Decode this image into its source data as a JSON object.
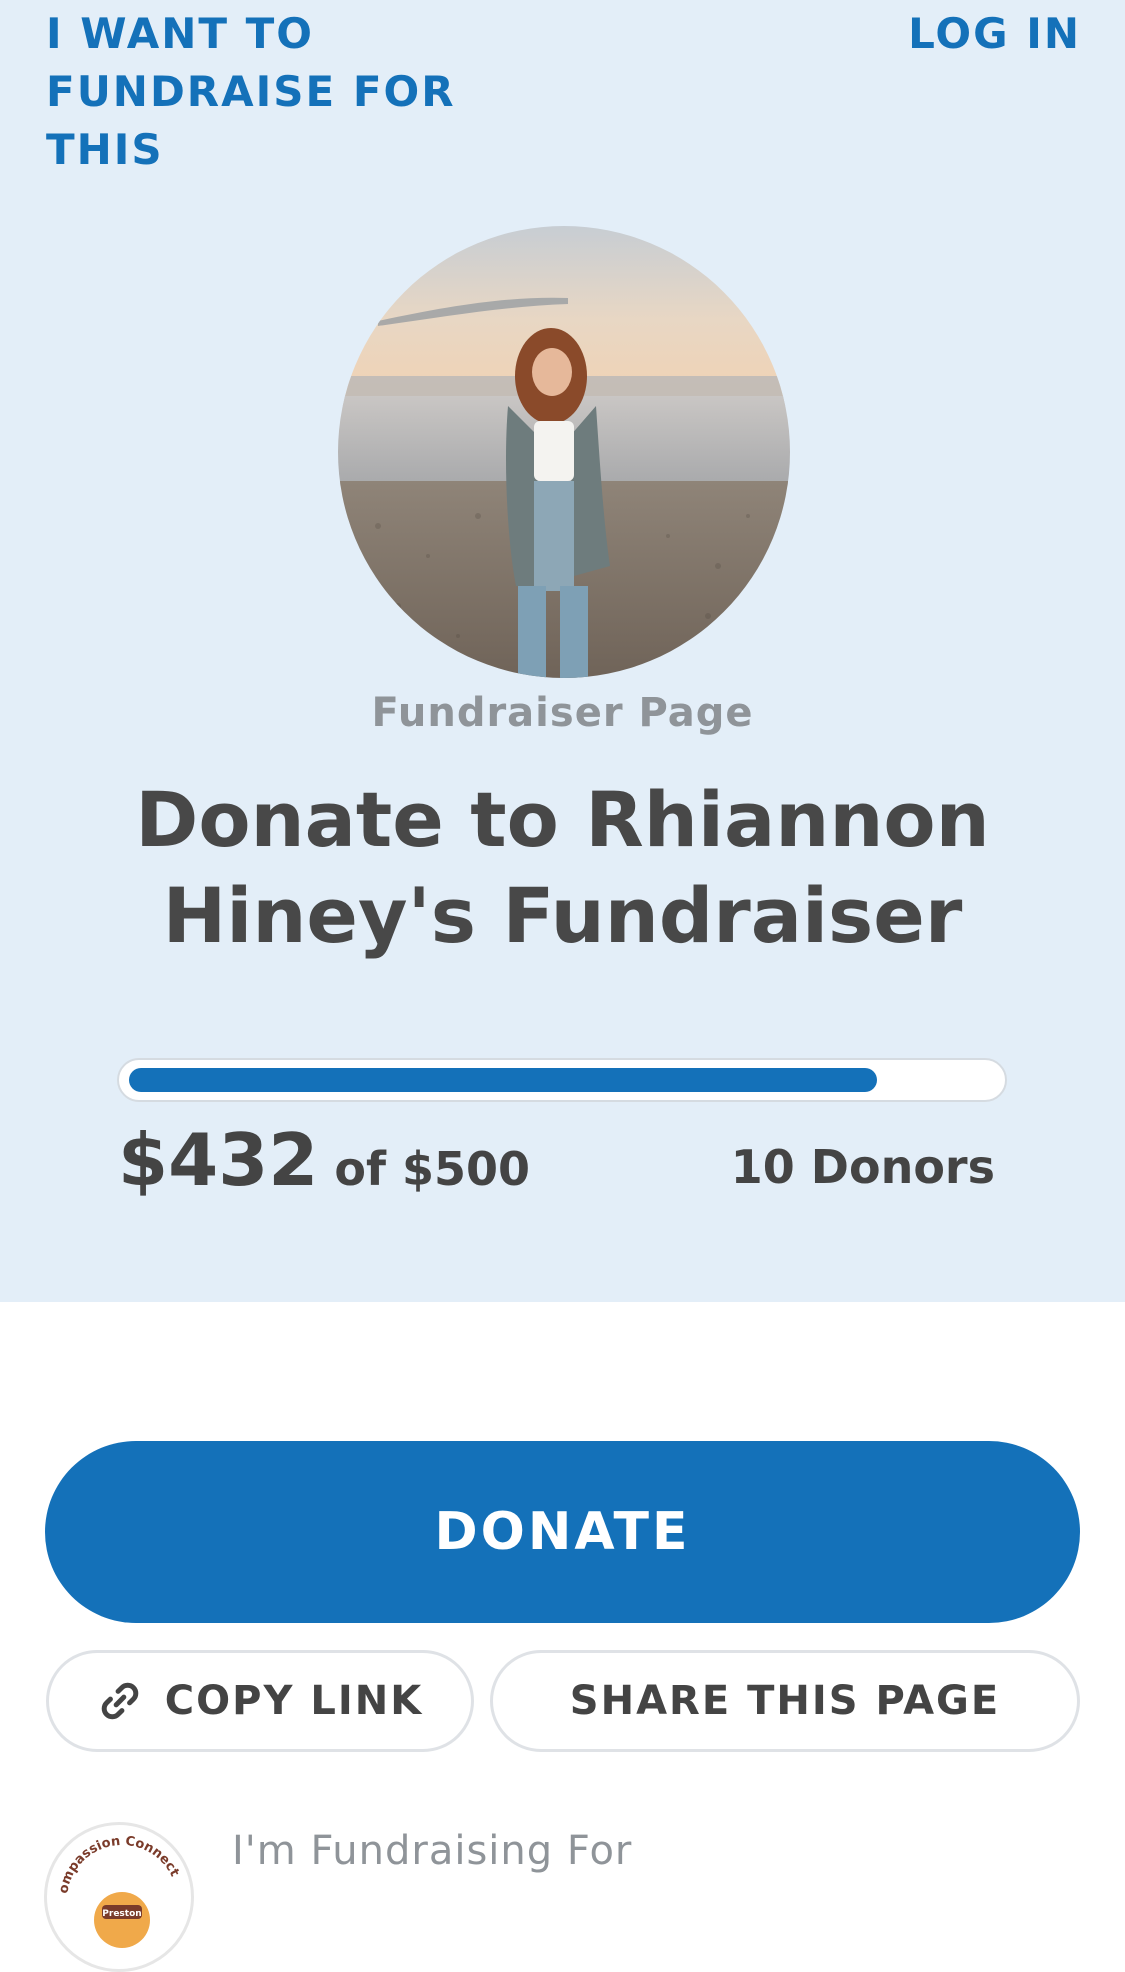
{
  "header": {
    "fundraise_link": "I WANT TO FUNDRAISE FOR THIS",
    "login_link": "LOG IN"
  },
  "hero": {
    "page_kind": "Fundraiser Page",
    "title": "Donate to Rhiannon Hiney's Fundraiser"
  },
  "progress": {
    "raised": "$432",
    "goal_text": "of $500",
    "donors": "10 Donors",
    "fraction": 0.864
  },
  "actions": {
    "donate_label": "DONATE",
    "copy_link_label": "COPY LINK",
    "share_label": "SHARE THIS PAGE"
  },
  "organization": {
    "fundraising_for_label": "I'm Fundraising For",
    "logo_text": "ompassion Connect",
    "logo_subtext": "Preston"
  },
  "icons": {
    "copy": "link-icon",
    "avatar": "profile-photo"
  },
  "colors": {
    "brand_blue": "#1471b9",
    "hero_background": "#e3eef8"
  }
}
